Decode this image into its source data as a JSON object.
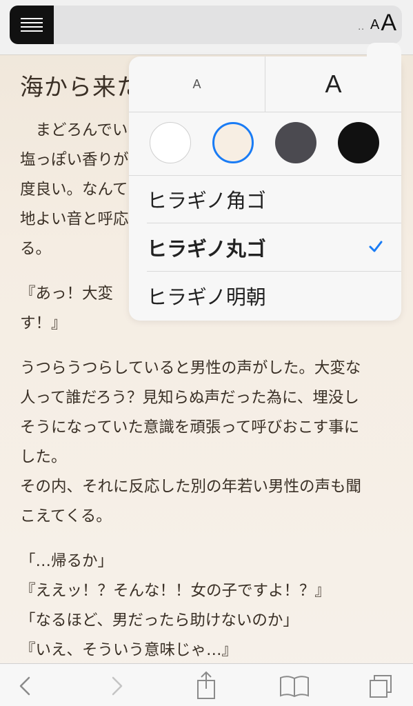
{
  "toolbar_top": {
    "reader_icon": "reader-list-icon",
    "font_settings": {
      "dots": "..",
      "small_a": "A",
      "big_a": "A"
    }
  },
  "article": {
    "title": "海から来た",
    "paragraphs": [
      [
        "　まどろんでい",
        "塩っぽい香りが",
        "度良い。なんて",
        "地よい音と呼応",
        "る。"
      ],
      [
        "『あっ！大変",
        "す！』"
      ],
      [
        "うつらうつらしていると男性の声がした。大変な",
        "人って誰だろう？見知らぬ声だった為に、埋没し",
        "そうになっていた意識を頑張って呼びおこす事に",
        "した。",
        "その内、それに反応した別の年若い男性の声も聞",
        "こえてくる。"
      ],
      [
        "「…帰るか」",
        "『ええッ！？そんな！！女の子ですよ！？』",
        "「なるほど、男だったら助けないのか」",
        "『いえ、そういう意味じゃ…』"
      ]
    ]
  },
  "popover": {
    "font_smaller": "A",
    "font_larger": "A",
    "themes": [
      {
        "name": "white",
        "color": "#ffffff"
      },
      {
        "name": "sepia",
        "color": "#f7eee3",
        "selected": true
      },
      {
        "name": "gray",
        "color": "#4b4a50"
      },
      {
        "name": "black",
        "color": "#111111"
      }
    ],
    "fonts": [
      {
        "label": "ヒラギノ角ゴ",
        "selected": false
      },
      {
        "label": "ヒラギノ丸ゴ",
        "selected": true
      },
      {
        "label": "ヒラギノ明朝",
        "selected": false
      }
    ],
    "accent": "#1a7cf5"
  },
  "toolbar_bottom": {
    "icons": [
      "back-chevron-icon",
      "forward-chevron-icon",
      "share-icon",
      "bookmarks-book-icon",
      "tabs-icon"
    ]
  }
}
